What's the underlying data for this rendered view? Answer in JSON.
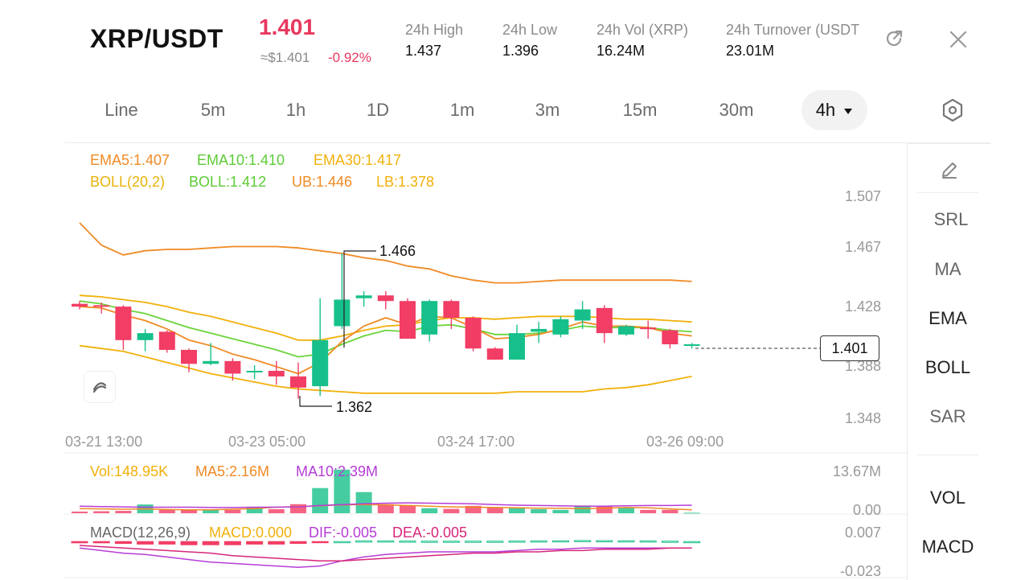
{
  "header": {
    "pair": "XRP/USDT",
    "price": "1.401",
    "fiat_price": "≈$1.401",
    "change": "-0.92%",
    "stats": [
      {
        "label": "24h  High",
        "value": "1.437"
      },
      {
        "label": "24h  Low",
        "value": "1.396"
      },
      {
        "label": "24h  Vol (XRP)",
        "value": "16.24M"
      },
      {
        "label": "24h  Turnover (USDT",
        "value": "23.01M"
      }
    ]
  },
  "timeframes": [
    "Line",
    "5m",
    "1h",
    "1D",
    "1m",
    "3m",
    "15m",
    "30m",
    "4h"
  ],
  "active_timeframe": "4h",
  "indicators": {
    "ema5": "EMA5:1.407",
    "ema10": "EMA10:1.410",
    "ema30": "EMA30:1.417",
    "boll": "BOLL(20,2)",
    "boll_mid": "BOLL:1.412",
    "ub": "UB:1.446",
    "lb": "LB:1.378"
  },
  "price_axis": [
    "1.507",
    "1.467",
    "1.428",
    "1.388",
    "1.348"
  ],
  "time_axis": [
    "03-21 13:00",
    "03-23 05:00",
    "03-24 17:00",
    "03-26 09:00"
  ],
  "high_marker": "1.466",
  "low_marker": "1.362",
  "last_price_tag": "1.401",
  "volume": {
    "vol": "Vol:148.95K",
    "ma5": "MA5:2.16M",
    "ma10": "MA10:2.39M",
    "axis_top": "13.67M",
    "axis_bottom": "0.00"
  },
  "macd": {
    "label": "MACD(12,26,9)",
    "macd": "MACD:0.000",
    "dif": "DIF:-0.005",
    "dea": "DEA:-0.005",
    "axis_top": "0.007",
    "axis_bottom": "-0.023"
  },
  "side_tools": [
    "SRL",
    "MA",
    "EMA",
    "BOLL",
    "SAR",
    "VOL",
    "MACD"
  ],
  "colors": {
    "up": "#17c08a",
    "down": "#f23d64",
    "ema5": "#f08a24",
    "ema10": "#6bd43a",
    "ema30": "#f2b00a",
    "boll_band": "#f2b00a",
    "ma10": "#b63cd6"
  },
  "chart_data": {
    "type": "candlestick",
    "series": [
      {
        "name": "candles",
        "ohlc": [
          [
            1.43,
            1.432,
            1.426,
            1.428
          ],
          [
            1.429,
            1.431,
            1.423,
            1.428
          ],
          [
            1.428,
            1.429,
            1.397,
            1.404
          ],
          [
            1.404,
            1.412,
            1.396,
            1.409
          ],
          [
            1.41,
            1.411,
            1.395,
            1.397
          ],
          [
            1.397,
            1.398,
            1.381,
            1.387
          ],
          [
            1.387,
            1.402,
            1.386,
            1.389
          ],
          [
            1.389,
            1.391,
            1.375,
            1.38
          ],
          [
            1.382,
            1.386,
            1.376,
            1.382
          ],
          [
            1.382,
            1.389,
            1.372,
            1.378
          ],
          [
            1.378,
            1.388,
            1.362,
            1.37
          ],
          [
            1.371,
            1.434,
            1.364,
            1.404
          ],
          [
            1.414,
            1.466,
            1.412,
            1.433
          ],
          [
            1.434,
            1.439,
            1.428,
            1.436
          ],
          [
            1.436,
            1.439,
            1.426,
            1.432
          ],
          [
            1.432,
            1.434,
            1.405,
            1.405
          ],
          [
            1.408,
            1.433,
            1.403,
            1.432
          ],
          [
            1.432,
            1.433,
            1.412,
            1.42
          ],
          [
            1.42,
            1.421,
            1.396,
            1.398
          ],
          [
            1.398,
            1.399,
            1.39,
            1.39
          ],
          [
            1.39,
            1.415,
            1.39,
            1.409
          ],
          [
            1.41,
            1.417,
            1.402,
            1.412
          ],
          [
            1.408,
            1.421,
            1.406,
            1.419
          ],
          [
            1.418,
            1.432,
            1.412,
            1.426
          ],
          [
            1.427,
            1.429,
            1.402,
            1.409
          ],
          [
            1.408,
            1.415,
            1.407,
            1.414
          ],
          [
            1.413,
            1.418,
            1.405,
            1.412
          ],
          [
            1.411,
            1.412,
            1.398,
            1.401
          ],
          [
            1.401,
            1.402,
            1.398,
            1.401
          ]
        ]
      }
    ],
    "ema5": [
      1.428,
      1.427,
      1.422,
      1.418,
      1.412,
      1.404,
      1.4,
      1.394,
      1.39,
      1.385,
      1.38,
      1.388,
      1.403,
      1.414,
      1.42,
      1.415,
      1.421,
      1.42,
      1.413,
      1.405,
      1.406,
      1.408,
      1.412,
      1.417,
      1.414,
      1.414,
      1.413,
      1.409,
      1.407
    ],
    "ema10": [
      1.432,
      1.43,
      1.426,
      1.423,
      1.418,
      1.413,
      1.409,
      1.405,
      1.401,
      1.397,
      1.392,
      1.394,
      1.401,
      1.407,
      1.411,
      1.41,
      1.414,
      1.415,
      1.412,
      1.408,
      1.408,
      1.409,
      1.411,
      1.414,
      1.413,
      1.413,
      1.413,
      1.411,
      1.41
    ],
    "ema30": [
      1.436,
      1.435,
      1.433,
      1.431,
      1.428,
      1.424,
      1.421,
      1.417,
      1.413,
      1.409,
      1.404,
      1.404,
      1.407,
      1.411,
      1.414,
      1.415,
      1.418,
      1.42,
      1.42,
      1.419,
      1.42,
      1.421,
      1.421,
      1.421,
      1.42,
      1.419,
      1.419,
      1.418,
      1.417
    ],
    "boll_ub": [
      1.488,
      1.472,
      1.465,
      1.468,
      1.469,
      1.469,
      1.47,
      1.471,
      1.471,
      1.471,
      1.47,
      1.468,
      1.466,
      1.463,
      1.461,
      1.457,
      1.455,
      1.45,
      1.447,
      1.445,
      1.445,
      1.446,
      1.447,
      1.447,
      1.447,
      1.447,
      1.447,
      1.447,
      1.446
    ],
    "boll_lb": [
      1.4,
      1.398,
      1.396,
      1.392,
      1.388,
      1.384,
      1.38,
      1.377,
      1.374,
      1.371,
      1.369,
      1.368,
      1.367,
      1.366,
      1.366,
      1.366,
      1.366,
      1.366,
      1.366,
      1.366,
      1.367,
      1.367,
      1.367,
      1.367,
      1.369,
      1.37,
      1.372,
      1.375,
      1.378
    ],
    "volume": [
      0.5,
      0.6,
      0.7,
      2.6,
      1.0,
      1.0,
      1.0,
      1.0,
      1.8,
      1.2,
      2.7,
      7.5,
      13.0,
      6.3,
      2.7,
      2.3,
      1.5,
      1.3,
      2.2,
      1.6,
      1.5,
      1.2,
      1.0,
      2.3,
      2.2,
      1.6,
      1.0,
      1.0,
      0.15
    ],
    "vol_ma5": [
      1.4,
      1.3,
      1.2,
      1.3,
      1.1,
      1.0,
      1.0,
      1.2,
      1.4,
      1.8,
      2.0,
      2.2,
      2.5,
      2.6,
      2.5,
      2.3,
      2.1,
      1.9,
      1.8,
      1.7,
      1.6,
      1.5,
      1.5,
      1.4,
      1.5,
      1.7,
      1.6,
      1.3,
      1.0
    ],
    "vol_ma10": [
      2.1,
      2.0,
      1.9,
      1.8,
      1.8,
      1.8,
      1.7,
      1.7,
      1.8,
      1.8,
      1.9,
      2.3,
      2.6,
      2.8,
      3.0,
      3.1,
      3.0,
      2.9,
      2.8,
      2.6,
      2.4,
      2.3,
      2.2,
      2.1,
      2.1,
      2.2,
      2.3,
      2.3,
      2.4
    ],
    "macd_hist": [
      -0.001,
      -0.001,
      -0.0015,
      -0.002,
      -0.002,
      -0.0025,
      -0.0025,
      -0.0025,
      -0.002,
      -0.002,
      -0.0015,
      -0.0008,
      0.0,
      0.0005,
      0.0005,
      0.0004,
      0.0003,
      0.0003,
      0.0003,
      0.0003,
      0.0004,
      0.0005,
      0.0006,
      0.0008,
      0.0007,
      0.0006,
      0.0005,
      0.0003,
      0.0
    ],
    "dif": [
      -0.005,
      -0.007,
      -0.009,
      -0.01,
      -0.012,
      -0.014,
      -0.016,
      -0.017,
      -0.018,
      -0.019,
      -0.02,
      -0.019,
      -0.015,
      -0.012,
      -0.01,
      -0.009,
      -0.008,
      -0.008,
      -0.008,
      -0.008,
      -0.007,
      -0.006,
      -0.006,
      -0.005,
      -0.005,
      -0.005,
      -0.005,
      -0.005,
      -0.005
    ],
    "dea": [
      -0.003,
      -0.004,
      -0.005,
      -0.006,
      -0.007,
      -0.008,
      -0.009,
      -0.011,
      -0.012,
      -0.013,
      -0.014,
      -0.015,
      -0.015,
      -0.014,
      -0.013,
      -0.012,
      -0.011,
      -0.01,
      -0.009,
      -0.009,
      -0.008,
      -0.008,
      -0.007,
      -0.007,
      -0.006,
      -0.006,
      -0.006,
      -0.005,
      -0.005
    ],
    "y_range": [
      1.348,
      1.507
    ],
    "vol_range": [
      0,
      13.67
    ],
    "macd_range": [
      -0.023,
      0.007
    ]
  }
}
